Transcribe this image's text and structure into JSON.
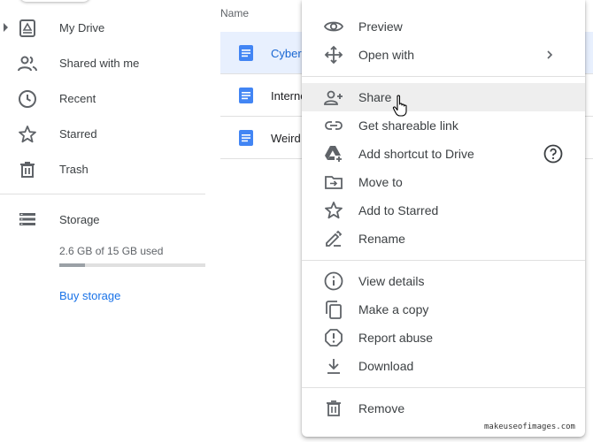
{
  "sidebar": {
    "items": [
      {
        "label": "My Drive",
        "icon": "drive-icon"
      },
      {
        "label": "Shared with me",
        "icon": "people-icon"
      },
      {
        "label": "Recent",
        "icon": "clock-icon"
      },
      {
        "label": "Starred",
        "icon": "star-icon"
      },
      {
        "label": "Trash",
        "icon": "trash-icon"
      }
    ],
    "storage": {
      "label": "Storage",
      "used_text": "2.6 GB of 15 GB used",
      "used_fraction": 0.173,
      "buy_label": "Buy storage"
    }
  },
  "file_list": {
    "column_header": "Name",
    "files": [
      {
        "name": "Cybersecurity",
        "selected": true
      },
      {
        "name": "Internet",
        "selected": false
      },
      {
        "name": "Weird",
        "selected": false
      }
    ]
  },
  "context_menu": {
    "items": [
      {
        "label": "Preview",
        "icon": "eye-icon"
      },
      {
        "label": "Open with",
        "icon": "move-arrows-icon",
        "submenu": true
      },
      {
        "label": "Share",
        "icon": "person-add-icon",
        "hovered": true
      },
      {
        "label": "Get shareable link",
        "icon": "link-icon"
      },
      {
        "label": "Add shortcut to Drive",
        "icon": "drive-shortcut-icon",
        "help": true
      },
      {
        "label": "Move to",
        "icon": "folder-move-icon"
      },
      {
        "label": "Add to Starred",
        "icon": "star-icon"
      },
      {
        "label": "Rename",
        "icon": "pencil-icon"
      },
      {
        "label": "View details",
        "icon": "info-icon"
      },
      {
        "label": "Make a copy",
        "icon": "copy-icon"
      },
      {
        "label": "Report abuse",
        "icon": "alert-icon"
      },
      {
        "label": "Download",
        "icon": "download-icon"
      },
      {
        "label": "Remove",
        "icon": "trash-icon"
      }
    ]
  },
  "watermark": "makeuseofimages.com",
  "colors": {
    "accent": "#1a73e8",
    "selected_row": "#e8f0fe",
    "doc_blue": "#4285f4",
    "hover": "#eeeeee"
  }
}
